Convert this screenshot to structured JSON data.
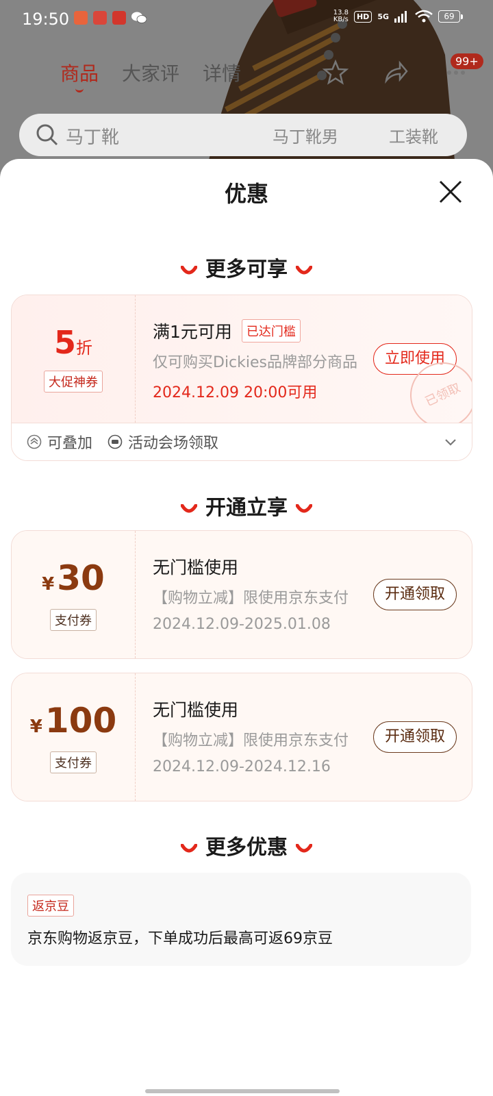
{
  "status_bar": {
    "time": "19:50",
    "net_speed_value": "13.8",
    "net_speed_unit": "KB/s",
    "hd": "HD",
    "signal": "5G",
    "battery": "69"
  },
  "background": {
    "tabs": [
      "商品",
      "大家评",
      "详情"
    ],
    "active_tab": "商品",
    "cart_badge": "99+",
    "search_placeholder": "马丁靴",
    "search_chips": [
      "马丁靴男",
      "工装靴"
    ]
  },
  "sheet": {
    "title": "优惠",
    "sections": [
      {
        "heading": "更多可享",
        "coupon": {
          "value": "5",
          "unit": "折",
          "tag": "大促神券",
          "title": "满1元可用",
          "badge": "已达门槛",
          "desc": "仅可购买Dickies品牌部分商品",
          "date": "2024.12.09 20:00可用",
          "button": "立即使用",
          "stamp": "已领取",
          "footer": [
            "可叠加",
            "活动会场领取"
          ]
        }
      },
      {
        "heading": "开通立享",
        "coupons": [
          {
            "currency": "¥",
            "value": "30",
            "tag": "支付券",
            "title": "无门槛使用",
            "desc": "【购物立减】限使用京东支付",
            "date": "2024.12.09-2025.01.08",
            "button": "开通领取"
          },
          {
            "currency": "¥",
            "value": "100",
            "tag": "支付券",
            "title": "无门槛使用",
            "desc": "【购物立减】限使用京东支付",
            "date": "2024.12.09-2024.12.16",
            "button": "开通领取"
          }
        ]
      },
      {
        "heading": "更多优惠",
        "promo": {
          "tag": "返京豆",
          "text": "京东购物返京豆，下单成功后最高可返69京豆"
        }
      }
    ]
  },
  "colors": {
    "accent_red": "#e3281b",
    "accent_brown": "#8b3a10",
    "brand_red": "#b0291c"
  }
}
